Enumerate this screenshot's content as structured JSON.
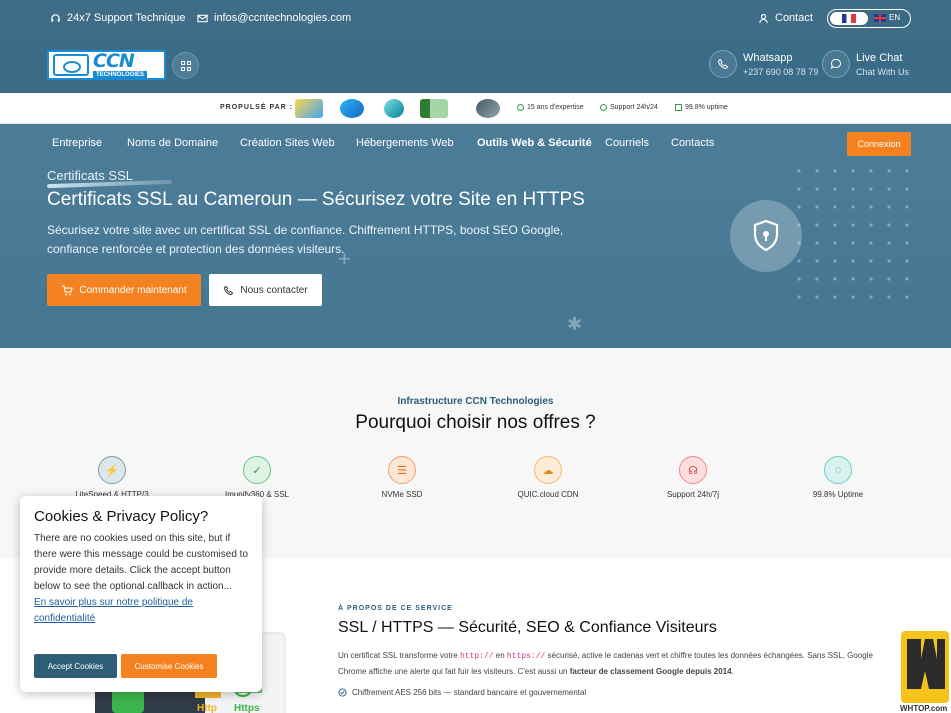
{
  "topbar": {
    "support": "24x7 Support Technique",
    "email": "infos@ccntechnologies.com",
    "contact": "Contact",
    "lang_en": "EN"
  },
  "header": {
    "logo_text": "CCN",
    "logo_sub": "TECHNOLOGIES",
    "whatsapp_title": "Whatsapp",
    "whatsapp_number": "+237 690 08 78 79",
    "livechat_title": "Live Chat",
    "livechat_sub": "Chat With Us"
  },
  "powered": {
    "label": "PROPULSÉ PAR :",
    "stats": [
      "15 ans d'expertise",
      "Support 24h/24",
      "99.8% uptime"
    ]
  },
  "nav": {
    "items": [
      "Entreprise",
      "Noms de Domaine",
      "Création Sites Web",
      "Hébergements Web",
      "Outils Web & Sécurité",
      "Courriels",
      "Contacts"
    ],
    "login": "Connexion"
  },
  "hero": {
    "kicker": "Certificats SSL",
    "title": "Certificats SSL au Cameroun — Sécurisez votre Site en HTTPS",
    "description": "Sécurisez votre site avec un certificat SSL de confiance. Chiffrement HTTPS, boost SEO Google, confiance renforcée et protection des données visiteurs.",
    "order_button": "Commander maintenant",
    "contact_button": "Nous contacter"
  },
  "why": {
    "subtitle": "Infrastructure CCN Technologies",
    "title": "Pourquoi choisir nos offres ?",
    "features": [
      "LiteSpeed & HTTP/3",
      "Imunify360 & SSL",
      "NVMe SSD",
      "QUIC.cloud CDN",
      "Support 24h/7j",
      "99.8% Uptime"
    ]
  },
  "about": {
    "kicker": "À PROPOS DE CE SERVICE",
    "title": "SSL / HTTPS — Sécurité, SEO & Confiance Visiteurs",
    "p_1": "Un certificat SSL transforme votre ",
    "code_http": "http://",
    "p_2": " en ",
    "code_https": "https://",
    "p_3": " sécurisé, active le cadenas vert et chiffre toutes les données échangées. Sans SSL, Google Chrome affiche une alerte qui fait fuir les visiteurs. C'est aussi un ",
    "p_bold": "facteur de classement Google depuis 2014",
    "p_4": ".",
    "list_item": "Chiffrement AES 256 bits — standard bancaire et gouvernemental",
    "illus_http": "Http",
    "illus_https": "Https"
  },
  "cookie": {
    "title": "Cookies & Privacy Policy?",
    "message": "There are no cookies used on this site, but if there were this message could be customised to provide more details. Click the accept button below to see the optional callback in action...",
    "link": "En savoir plus sur notre politique de confidentialité",
    "accept": "Accept Cookies",
    "customise": "Customise Cookies"
  },
  "watermark": {
    "label": "WHTOP.com"
  },
  "colors": {
    "topbar": "#3f6d88",
    "nav": "#4a7b97",
    "accent": "#f58220",
    "dark_button": "#2f5f78"
  }
}
